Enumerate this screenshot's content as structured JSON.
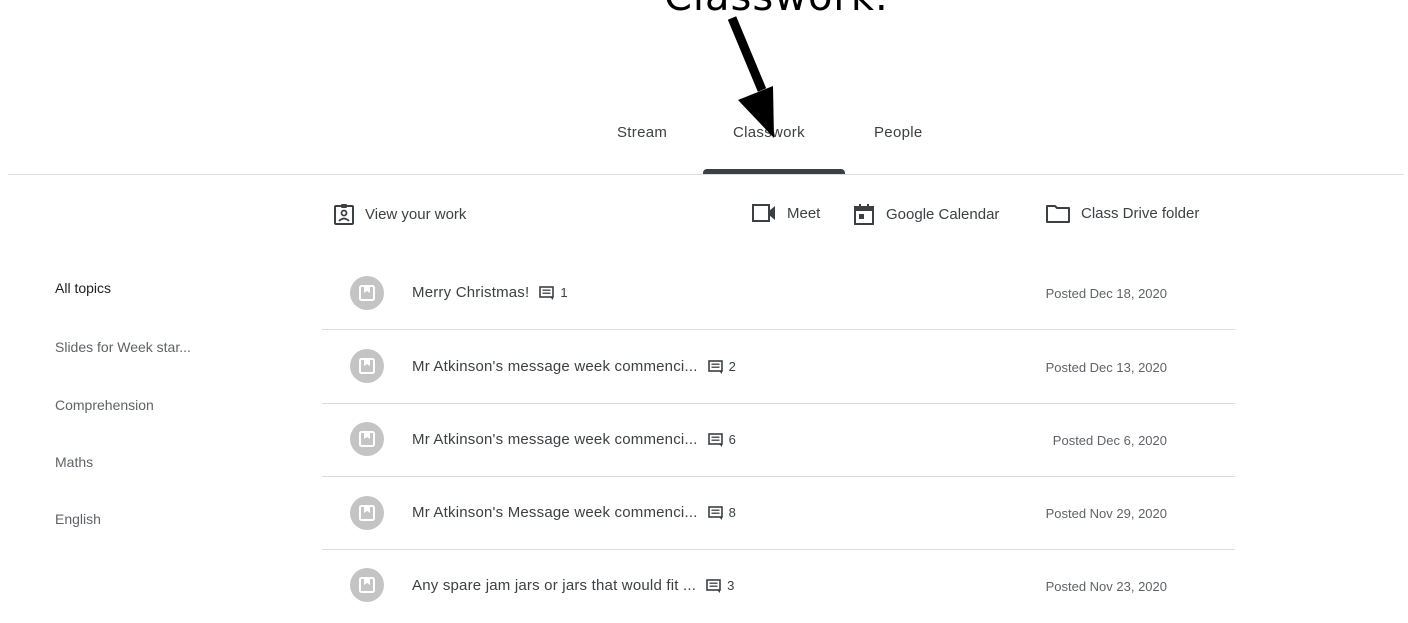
{
  "annotation": {
    "text": "Classwork."
  },
  "tabs": [
    {
      "label": "Stream"
    },
    {
      "label": "Classwork"
    },
    {
      "label": "People"
    }
  ],
  "toolbar": {
    "view_work_label": "View your work",
    "meet_label": "Meet",
    "calendar_label": "Google Calendar",
    "drive_label": "Class Drive folder"
  },
  "topics": [
    {
      "label": "All topics"
    },
    {
      "label": "Slides for Week star..."
    },
    {
      "label": "Comprehension"
    },
    {
      "label": "Maths"
    },
    {
      "label": "English"
    }
  ],
  "posts": [
    {
      "title": "Merry Christmas!",
      "comments": "1",
      "date": "Posted Dec 18, 2020"
    },
    {
      "title": "Mr Atkinson's message week commenci...",
      "comments": "2",
      "date": "Posted Dec 13, 2020"
    },
    {
      "title": "Mr Atkinson's message week commenci...",
      "comments": "6",
      "date": "Posted Dec 6, 2020"
    },
    {
      "title": "Mr Atkinson's Message week commenci...",
      "comments": "8",
      "date": "Posted Nov 29, 2020"
    },
    {
      "title": "Any spare jam jars or jars that would fit ...",
      "comments": "3",
      "date": "Posted Nov 23, 2020"
    }
  ],
  "colors": {
    "text": "#3c4043",
    "secondary": "#5f6368",
    "divider": "#dadce0",
    "avatar": "#c4c4c4"
  }
}
